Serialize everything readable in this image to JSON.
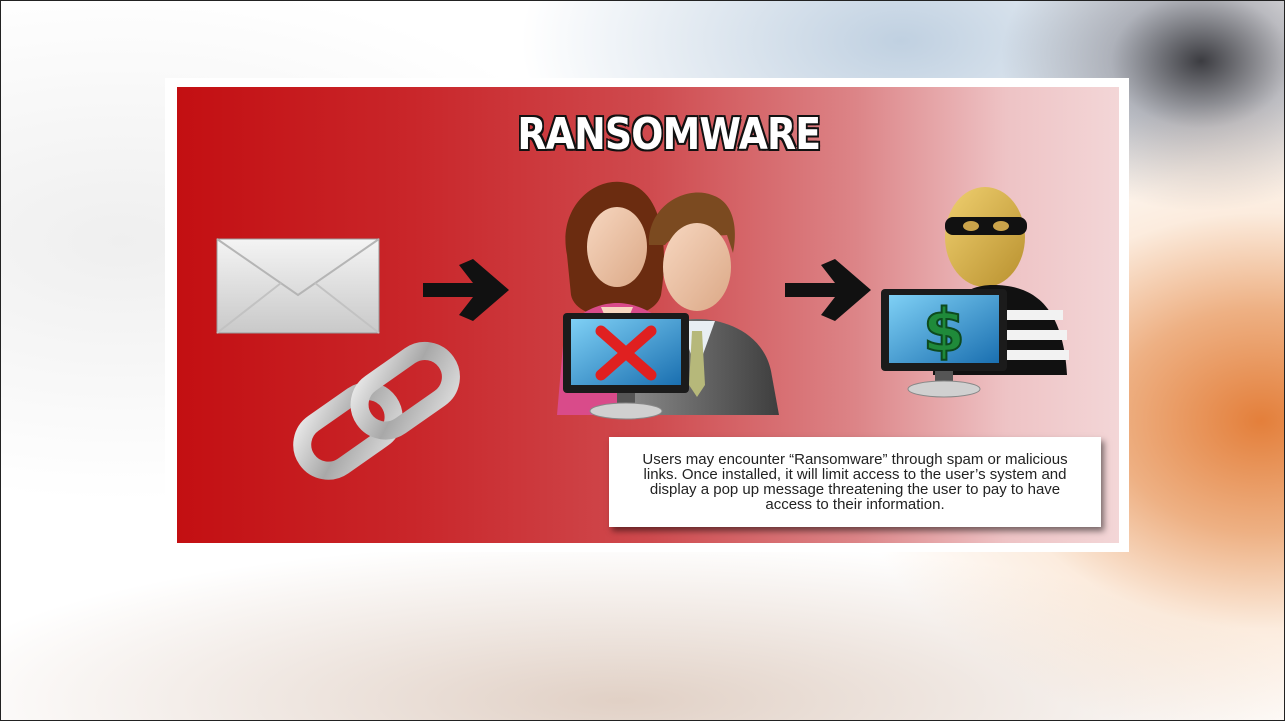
{
  "slide": {
    "title": "RANSOMWARE",
    "description": "Users may encounter “Ransomware” through spam or malicious links. Once installed, it will limit access to the user’s system and display a pop up message threatening the user to pay to have access to their information."
  },
  "icons": [
    "envelope-icon",
    "chain-link-icon",
    "arrow-right-icon",
    "users-icon",
    "monitor-x-icon",
    "arrow-right-icon",
    "thief-icon",
    "monitor-dollar-icon"
  ],
  "colors": {
    "panel_left": "#c30f12",
    "panel_right": "#f3d6d7",
    "x_mark": "#e02020",
    "dollar": "#1f8a3a"
  }
}
